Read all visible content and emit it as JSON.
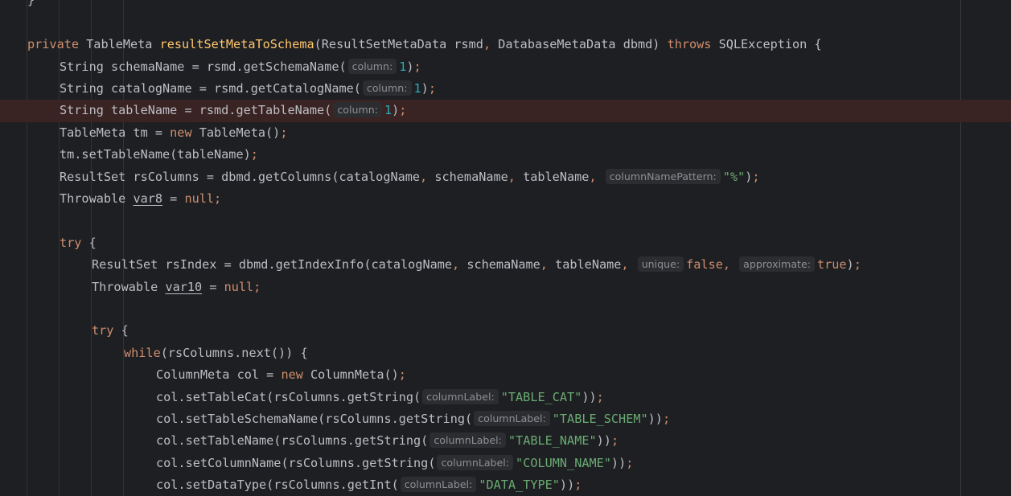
{
  "editor": {
    "colors": {
      "background": "#1e1f22",
      "keyword": "#cf8e6d",
      "method_declaration": "#ffc66d",
      "string": "#6aab73",
      "number": "#2aacb8",
      "default_text": "#bcbec4",
      "inlay_hint_bg": "#2b2d30",
      "highlighted_line_bg": "#3a2323"
    },
    "lines": [
      {
        "indent": 0,
        "tokens": [
          {
            "t": "}",
            "c": "plain"
          }
        ]
      },
      {
        "indent": 0,
        "tokens": []
      },
      {
        "indent": 0,
        "tokens": [
          {
            "t": "private",
            "c": "kw"
          },
          {
            "t": " TableMeta ",
            "c": "plain"
          },
          {
            "t": "resultSetMetaToSchema",
            "c": "fn"
          },
          {
            "t": "(ResultSetMetaData rsmd",
            "c": "plain"
          },
          {
            "t": ",",
            "c": "pun"
          },
          {
            "t": " DatabaseMetaData dbmd) ",
            "c": "plain"
          },
          {
            "t": "throws",
            "c": "kw"
          },
          {
            "t": " SQLException {",
            "c": "plain"
          }
        ]
      },
      {
        "indent": 1,
        "tokens": [
          {
            "t": "String schemaName = rsmd.getSchemaName(",
            "c": "plain"
          },
          {
            "t": "column:",
            "c": "hint"
          },
          {
            "t": "1",
            "c": "num"
          },
          {
            "t": ")",
            "c": "plain"
          },
          {
            "t": ";",
            "c": "pun"
          }
        ]
      },
      {
        "indent": 1,
        "tokens": [
          {
            "t": "String catalogName = rsmd.getCatalogName(",
            "c": "plain"
          },
          {
            "t": "column:",
            "c": "hint"
          },
          {
            "t": "1",
            "c": "num"
          },
          {
            "t": ")",
            "c": "plain"
          },
          {
            "t": ";",
            "c": "pun"
          }
        ]
      },
      {
        "indent": 1,
        "highlight": true,
        "tokens": [
          {
            "t": "String tableName = rsmd.getTableName(",
            "c": "plain"
          },
          {
            "t": "column:",
            "c": "hint"
          },
          {
            "t": "1",
            "c": "num"
          },
          {
            "t": ")",
            "c": "plain"
          },
          {
            "t": ";",
            "c": "pun"
          }
        ]
      },
      {
        "indent": 1,
        "tokens": [
          {
            "t": "TableMeta tm = ",
            "c": "plain"
          },
          {
            "t": "new",
            "c": "kw"
          },
          {
            "t": " TableMeta()",
            "c": "plain"
          },
          {
            "t": ";",
            "c": "pun"
          }
        ]
      },
      {
        "indent": 1,
        "tokens": [
          {
            "t": "tm.setTableName(tableName)",
            "c": "plain"
          },
          {
            "t": ";",
            "c": "pun"
          }
        ]
      },
      {
        "indent": 1,
        "tokens": [
          {
            "t": "ResultSet rsColumns = dbmd.getColumns(catalogName",
            "c": "plain"
          },
          {
            "t": ",",
            "c": "pun"
          },
          {
            "t": " schemaName",
            "c": "plain"
          },
          {
            "t": ",",
            "c": "pun"
          },
          {
            "t": " tableName",
            "c": "plain"
          },
          {
            "t": ",",
            "c": "pun"
          },
          {
            "t": " ",
            "c": "plain"
          },
          {
            "t": "columnNamePattern:",
            "c": "hint"
          },
          {
            "t": "\"%\"",
            "c": "str"
          },
          {
            "t": ")",
            "c": "plain"
          },
          {
            "t": ";",
            "c": "pun"
          }
        ]
      },
      {
        "indent": 1,
        "tokens": [
          {
            "t": "Throwable ",
            "c": "plain"
          },
          {
            "t": "var8",
            "c": "ul"
          },
          {
            "t": " = ",
            "c": "plain"
          },
          {
            "t": "null",
            "c": "kw"
          },
          {
            "t": ";",
            "c": "pun"
          }
        ]
      },
      {
        "indent": 0,
        "tokens": []
      },
      {
        "indent": 1,
        "tokens": [
          {
            "t": "try",
            "c": "kw"
          },
          {
            "t": " {",
            "c": "plain"
          }
        ]
      },
      {
        "indent": 2,
        "tokens": [
          {
            "t": "ResultSet rsIndex = dbmd.getIndexInfo(catalogName",
            "c": "plain"
          },
          {
            "t": ",",
            "c": "pun"
          },
          {
            "t": " schemaName",
            "c": "plain"
          },
          {
            "t": ",",
            "c": "pun"
          },
          {
            "t": " tableName",
            "c": "plain"
          },
          {
            "t": ",",
            "c": "pun"
          },
          {
            "t": " ",
            "c": "plain"
          },
          {
            "t": "unique:",
            "c": "hint"
          },
          {
            "t": "false",
            "c": "kw"
          },
          {
            "t": ",",
            "c": "pun"
          },
          {
            "t": " ",
            "c": "plain"
          },
          {
            "t": "approximate:",
            "c": "hint"
          },
          {
            "t": "true",
            "c": "kw"
          },
          {
            "t": ")",
            "c": "plain"
          },
          {
            "t": ";",
            "c": "pun"
          }
        ]
      },
      {
        "indent": 2,
        "tokens": [
          {
            "t": "Throwable ",
            "c": "plain"
          },
          {
            "t": "var10",
            "c": "ul"
          },
          {
            "t": " = ",
            "c": "plain"
          },
          {
            "t": "null",
            "c": "kw"
          },
          {
            "t": ";",
            "c": "pun"
          }
        ]
      },
      {
        "indent": 0,
        "tokens": []
      },
      {
        "indent": 2,
        "tokens": [
          {
            "t": "try",
            "c": "kw"
          },
          {
            "t": " {",
            "c": "plain"
          }
        ]
      },
      {
        "indent": 3,
        "tokens": [
          {
            "t": "while",
            "c": "kw"
          },
          {
            "t": "(rsColumns.next()) {",
            "c": "plain"
          }
        ]
      },
      {
        "indent": 4,
        "tokens": [
          {
            "t": "ColumnMeta col = ",
            "c": "plain"
          },
          {
            "t": "new",
            "c": "kw"
          },
          {
            "t": " ColumnMeta()",
            "c": "plain"
          },
          {
            "t": ";",
            "c": "pun"
          }
        ]
      },
      {
        "indent": 4,
        "tokens": [
          {
            "t": "col.setTableCat(rsColumns.getString(",
            "c": "plain"
          },
          {
            "t": "columnLabel:",
            "c": "hint"
          },
          {
            "t": "\"TABLE_CAT\"",
            "c": "str"
          },
          {
            "t": "))",
            "c": "plain"
          },
          {
            "t": ";",
            "c": "pun"
          }
        ]
      },
      {
        "indent": 4,
        "tokens": [
          {
            "t": "col.setTableSchemaName(rsColumns.getString(",
            "c": "plain"
          },
          {
            "t": "columnLabel:",
            "c": "hint"
          },
          {
            "t": "\"TABLE_SCHEM\"",
            "c": "str"
          },
          {
            "t": "))",
            "c": "plain"
          },
          {
            "t": ";",
            "c": "pun"
          }
        ]
      },
      {
        "indent": 4,
        "tokens": [
          {
            "t": "col.setTableName(rsColumns.getString(",
            "c": "plain"
          },
          {
            "t": "columnLabel:",
            "c": "hint"
          },
          {
            "t": "\"TABLE_NAME\"",
            "c": "str"
          },
          {
            "t": "))",
            "c": "plain"
          },
          {
            "t": ";",
            "c": "pun"
          }
        ]
      },
      {
        "indent": 4,
        "tokens": [
          {
            "t": "col.setColumnName(rsColumns.getString(",
            "c": "plain"
          },
          {
            "t": "columnLabel:",
            "c": "hint"
          },
          {
            "t": "\"COLUMN_NAME\"",
            "c": "str"
          },
          {
            "t": "))",
            "c": "plain"
          },
          {
            "t": ";",
            "c": "pun"
          }
        ]
      },
      {
        "indent": 4,
        "tokens": [
          {
            "t": "col.setDataType(rsColumns.getInt(",
            "c": "plain"
          },
          {
            "t": "columnLabel:",
            "c": "hint"
          },
          {
            "t": "\"DATA_TYPE\"",
            "c": "str"
          },
          {
            "t": "))",
            "c": "plain"
          },
          {
            "t": ";",
            "c": "pun"
          }
        ]
      }
    ]
  }
}
